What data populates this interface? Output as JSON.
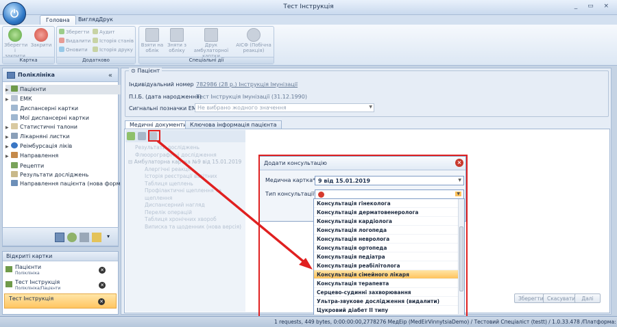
{
  "window": {
    "title": "Тест Інструкція",
    "controls": "_ ▭ ×"
  },
  "orb": {
    "glyph": "⏻"
  },
  "ribbon_tabs": [
    "Головна",
    "Вигляд",
    "Друк"
  ],
  "ribbon": {
    "karta": {
      "label": "Картка",
      "save_close": "Зберегти і закрити",
      "close": "Закрити"
    },
    "dodatkovo": {
      "label": "Додатково",
      "save": "Зберегти",
      "delete": "Видалити",
      "refresh": "Оновити",
      "audit": "Аудит",
      "state_history": "Історія станів",
      "print_history": "Історія друку"
    },
    "special": {
      "label": "Спеціальні дії",
      "take": "Взяти на облік",
      "remove": "Зняти з обліку",
      "print_card": "Друк амбулаторної картки",
      "aisf": "АІСФ (Побічна реакція)"
    }
  },
  "sidebar": {
    "title": "Поліклініка",
    "collapse": "«",
    "items": [
      {
        "label": "Пацієнти",
        "selected": true,
        "arrow": true
      },
      {
        "label": "ЕМК",
        "arrow": true
      },
      {
        "label": "Диспансерні картки"
      },
      {
        "label": "Мої диспансерні картки"
      },
      {
        "label": "Статистичні талони",
        "arrow": true
      },
      {
        "label": "Лікарняні листки",
        "arrow": true
      },
      {
        "label": "Реімбурсація ліків",
        "arrow": true
      },
      {
        "label": "Направлення",
        "arrow": true
      },
      {
        "label": "Рецепти"
      },
      {
        "label": "Результати досліджень"
      },
      {
        "label": "Направлення пацієнта (нова форма)"
      }
    ]
  },
  "open_cards": {
    "title": "Відкриті картки",
    "items": [
      {
        "label": "Пацієнти",
        "sub": "Поліклініка"
      },
      {
        "label": "Тест Інструкція",
        "sub": "Поліклініка/Пацієнти"
      },
      {
        "label": "Тест Інструкція",
        "sub": ""
      }
    ]
  },
  "patient": {
    "legend": "Пацієнт",
    "id_label": "Індивідуальний номер",
    "id_value": "782986 (28 р.) Інструкція Імунізації",
    "name_label": "П.І.Б. (дата народження)",
    "name_value": "Тест Інструкція Імунізації (31.12.1990)",
    "signals_label": "Сигнальні позначки ЕМК",
    "signals_value": "Не вибрано жодного значення"
  },
  "tabs": [
    "Медичні документи",
    "Ключова інформація пацієнта"
  ],
  "doclist": [
    "Результати досліджень",
    "Флюорографічні дослідження",
    "Амбулаторна картка №9 від 15.01.2019",
    "Алергічні реакції",
    "Історія реєстрації вагітних",
    "Таблиця щеплень",
    "Профілактичні щеплення та щеплення",
    "Диспансерний нагляд",
    "Перелік операцій",
    "Таблиця хронічних хвороб",
    "Виписка та щоденник (нова версія)"
  ],
  "dialog": {
    "title": "Додати консультацію",
    "card_label": "Медична картка*",
    "card_value": "9 від 15.01.2019",
    "type_label": "Тип консультації*"
  },
  "consult_options": [
    "Консультація гінеколога",
    "Консультація дерматовенеролога",
    "Консультація кардіолога",
    "Консультація логопеда",
    "Консультація невролога",
    "Консультація ортопеда",
    "Консультація педіатра",
    "Консультація реабілітолога",
    "Консультація сімейного лікаря",
    "Консультація терапевта",
    "Серцево-судинні захворювання",
    "Ультра-звукове дослідження (видалити)",
    "Цукровий діабет II типу"
  ],
  "highlighted_option": "Консультація сімейного лікаря",
  "footer_buttons": [
    "Зберегти",
    "Скасувати",
    "Далі"
  ],
  "status": "1 requests, 449 bytes, 0:00:00:00,2778276 МедЕір (MedEirVinnytsiaDemo) / Тестовий Спеціаліст (testt) / 1.0.33.478 /Платформа: 2.0.25(hf2)",
  "colors": {
    "accent": "#e02020",
    "highlight": "#ffc35c"
  }
}
